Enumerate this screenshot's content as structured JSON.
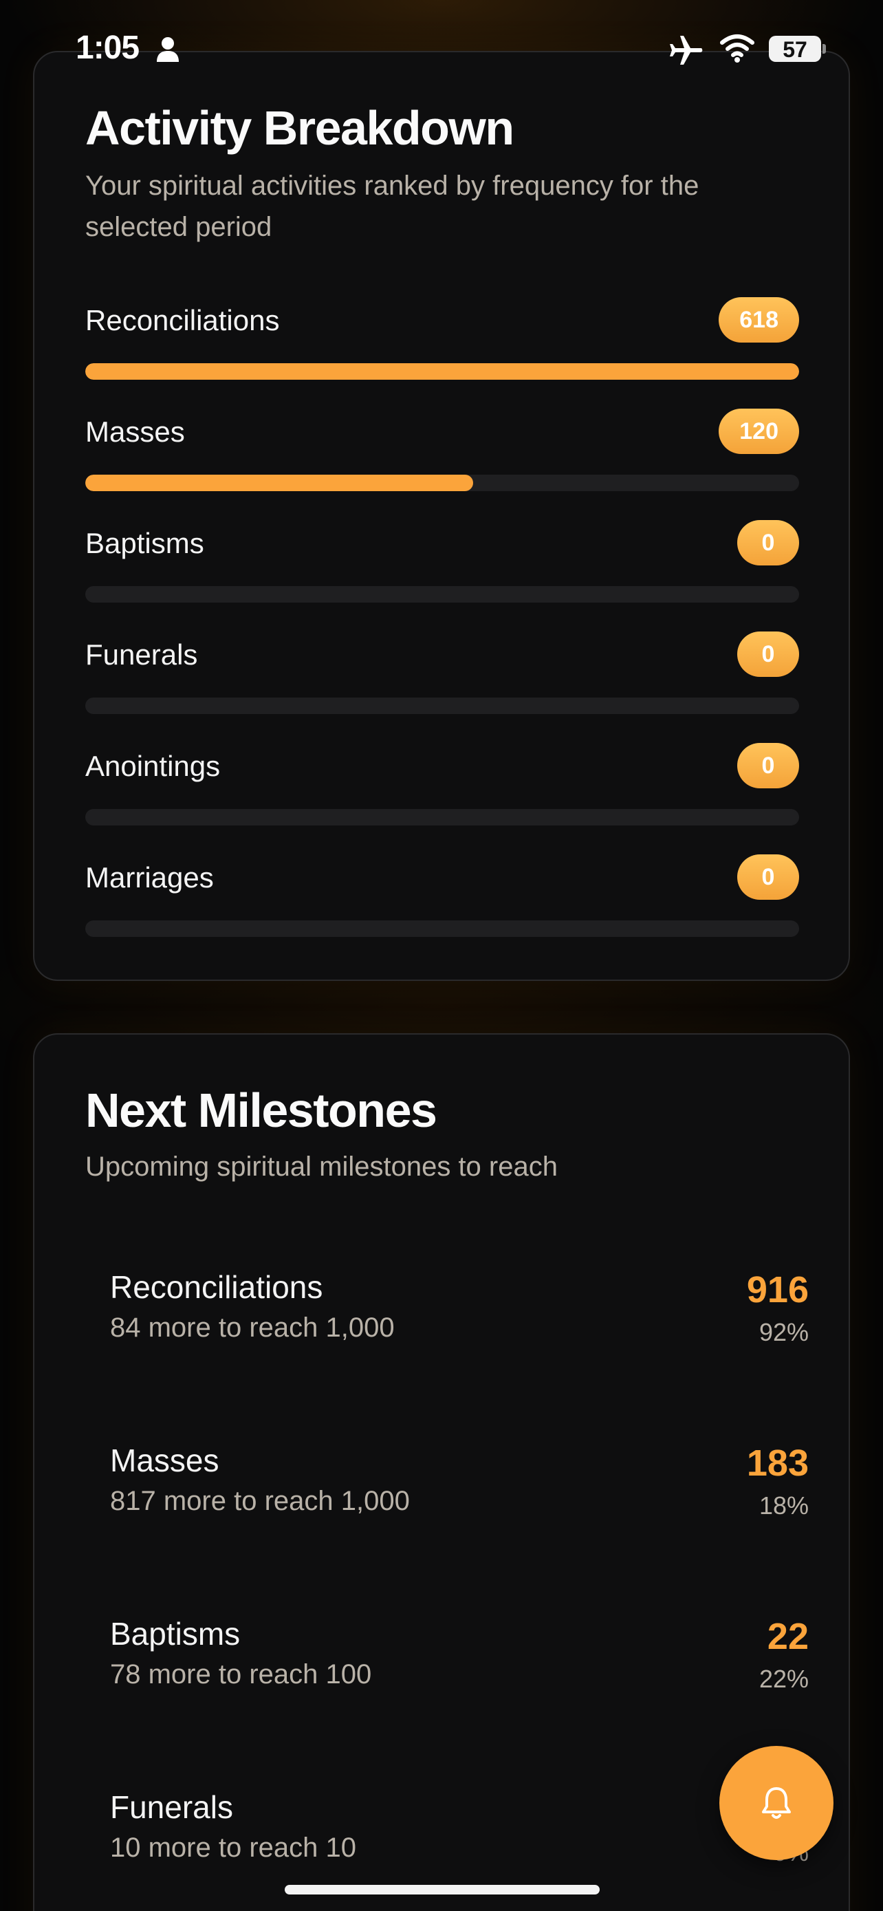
{
  "status_bar": {
    "time": "1:05",
    "battery": "57"
  },
  "activity": {
    "title": "Activity Breakdown",
    "subtitle": "Your spiritual activities ranked by frequency for the selected period",
    "items": [
      {
        "label": "Reconciliations",
        "count": "618",
        "fraction": 1.0
      },
      {
        "label": "Masses",
        "count": "120",
        "fraction": 0.543
      },
      {
        "label": "Baptisms",
        "count": "0",
        "fraction": 0
      },
      {
        "label": "Funerals",
        "count": "0",
        "fraction": 0
      },
      {
        "label": "Anointings",
        "count": "0",
        "fraction": 0
      },
      {
        "label": "Marriages",
        "count": "0",
        "fraction": 0
      }
    ]
  },
  "milestones": {
    "title": "Next Milestones",
    "subtitle": "Upcoming spiritual milestones to reach",
    "items": [
      {
        "label": "Reconciliations",
        "sub": "84 more to reach 1,000",
        "value": "916",
        "pct": "92%"
      },
      {
        "label": "Masses",
        "sub": "817 more to reach 1,000",
        "value": "183",
        "pct": "18%"
      },
      {
        "label": "Baptisms",
        "sub": "78 more to reach 100",
        "value": "22",
        "pct": "22%"
      },
      {
        "label": "Funerals",
        "sub": "10 more to reach 10",
        "value": "0",
        "pct": "0%"
      }
    ]
  },
  "colors": {
    "accent": "#fba43b",
    "background": "#050505",
    "card": "#0e0e0f"
  },
  "icons": {
    "fab": "bell-icon"
  }
}
